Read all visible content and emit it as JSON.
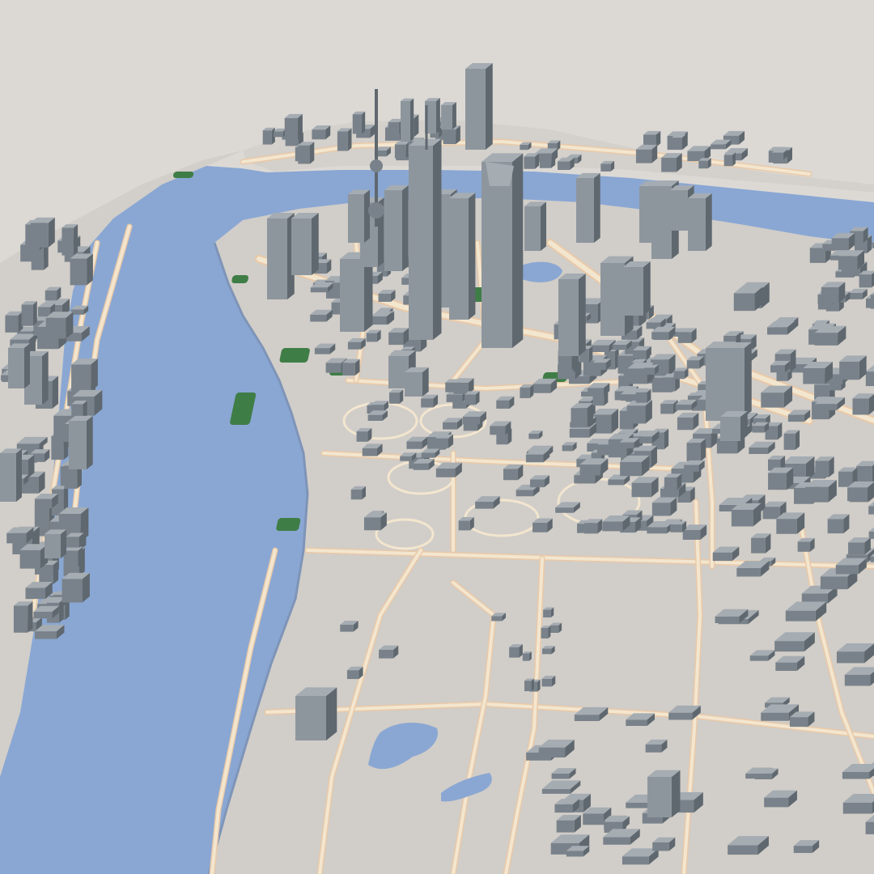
{
  "scene": {
    "kind": "3d-city-model-render",
    "palette": {
      "background": "#dcd9d5",
      "land": "#d4d0cb",
      "water": "#8aa7d3",
      "road": "#f3e6cf",
      "road_edge": "#e9c9a8",
      "road_major": "#e8b59a",
      "park": "#3f7d47",
      "building_light": "#8e969d",
      "building_mid": "#79828a",
      "building_dark": "#5f686f",
      "roof": "#a5acb2"
    }
  }
}
